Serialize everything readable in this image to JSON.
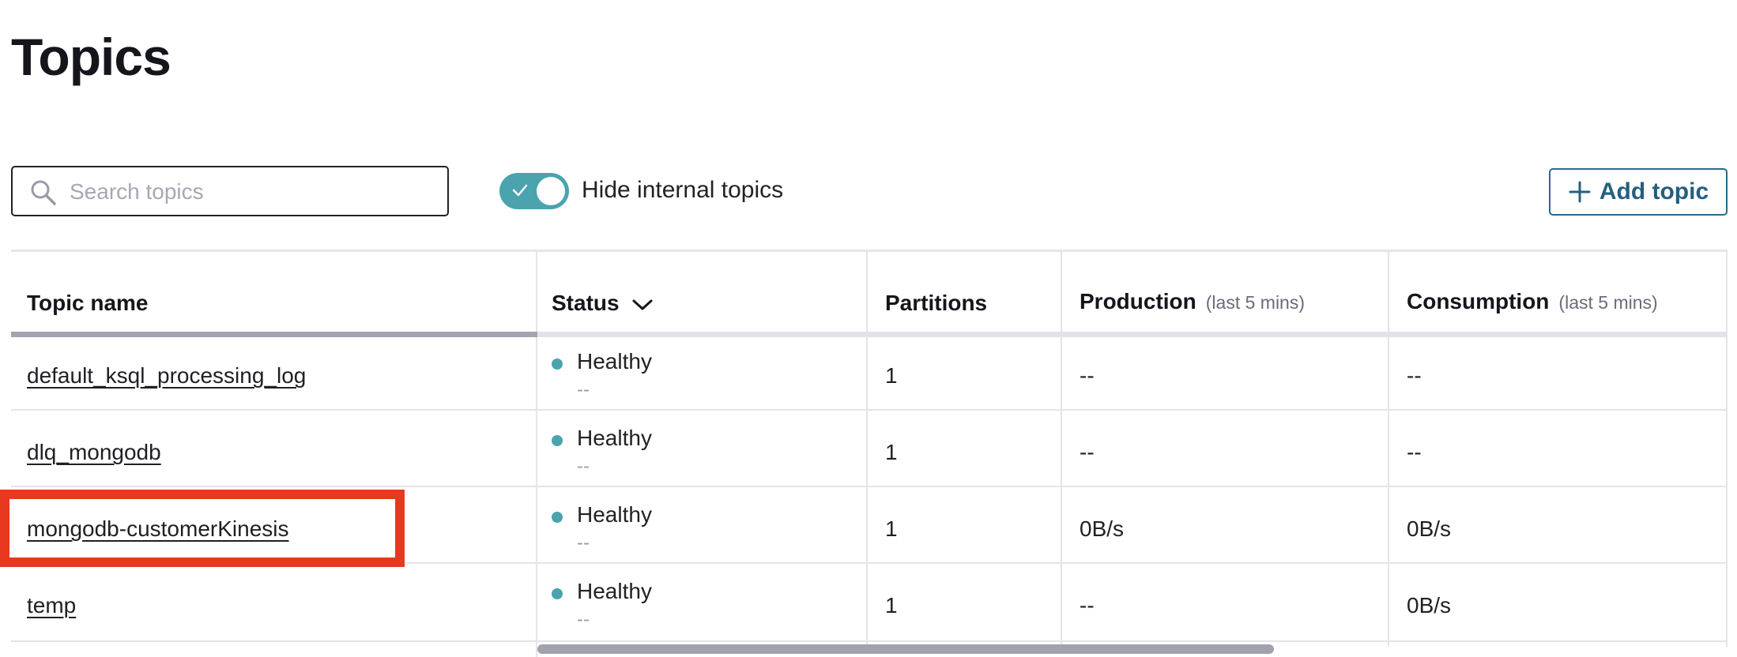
{
  "page": {
    "title": "Topics"
  },
  "toolbar": {
    "search_placeholder": "Search topics",
    "search_value": "",
    "hide_internal_label": "Hide internal topics",
    "hide_internal_on": true,
    "add_topic_label": "Add topic"
  },
  "table": {
    "columns": {
      "topic_name": "Topic name",
      "status": "Status",
      "partitions": "Partitions",
      "production": "Production",
      "production_sub": "(last 5 mins)",
      "consumption": "Consumption",
      "consumption_sub": "(last 5 mins)"
    },
    "rows": [
      {
        "name": "default_ksql_processing_log",
        "status": "Healthy",
        "status_sub": "--",
        "partitions": "1",
        "production": "--",
        "consumption": "--"
      },
      {
        "name": "dlq_mongodb",
        "status": "Healthy",
        "status_sub": "--",
        "partitions": "1",
        "production": "--",
        "consumption": "--"
      },
      {
        "name": "mongodb-customerKinesis",
        "status": "Healthy",
        "status_sub": "--",
        "partitions": "1",
        "production": "0B/s",
        "consumption": "0B/s"
      },
      {
        "name": "temp",
        "status": "Healthy",
        "status_sub": "--",
        "partitions": "1",
        "production": "--",
        "consumption": "0B/s"
      }
    ]
  },
  "colors": {
    "accent_teal": "#4aa3ad",
    "button_blue": "#245f7f",
    "highlight_red": "#e8381f"
  },
  "icons": {
    "search": "search-icon",
    "check": "check-icon",
    "plus": "plus-icon",
    "sort": "chevron-down-icon"
  }
}
